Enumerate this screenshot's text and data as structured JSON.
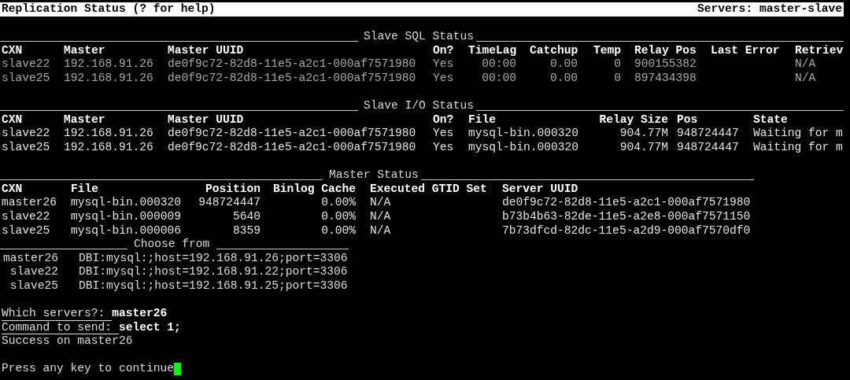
{
  "title_bar": {
    "title": "Replication Status (? for help)",
    "servers": "Servers: master-slave"
  },
  "slave_sql_status": {
    "title": "Slave SQL Status",
    "columns": [
      "CXN",
      "Master",
      "Master UUID",
      "On?",
      "TimeLag",
      "Catchup",
      "Temp",
      "Relay Pos",
      "Last Error",
      "Retriev"
    ],
    "rows": [
      [
        "slave22",
        "192.168.91.26",
        "de0f9c72-82d8-11e5-a2c1-000af7571980",
        "Yes",
        "00:00",
        "0.00",
        "0",
        "900155382",
        null,
        "N/A"
      ],
      [
        "slave25",
        "192.168.91.26",
        "de0f9c72-82d8-11e5-a2c1-000af7571980",
        "Yes",
        "00:00",
        "0.00",
        "0",
        "897434398",
        null,
        "N/A"
      ]
    ]
  },
  "slave_io_status": {
    "title": "Slave I/O Status",
    "columns": [
      "CXN",
      "Master",
      "Master UUID",
      "On?",
      "File",
      "Relay Size",
      "Pos",
      "State"
    ],
    "rows": [
      [
        "slave22",
        "192.168.91.26",
        "de0f9c72-82d8-11e5-a2c1-000af7571980",
        "Yes",
        "mysql-bin.000320",
        "904.77M",
        "948724447",
        "Waiting for m"
      ],
      [
        "slave25",
        "192.168.91.26",
        "de0f9c72-82d8-11e5-a2c1-000af7571980",
        "Yes",
        "mysql-bin.000320",
        "904.77M",
        "948724447",
        "Waiting for m"
      ]
    ]
  },
  "master_status": {
    "title": "Master Status",
    "columns": [
      "CXN",
      "File",
      "Position",
      "Binlog Cache",
      "Executed GTID Set",
      "Server UUID"
    ],
    "rows": [
      [
        "master26",
        "mysql-bin.000320",
        "948724447",
        "0.00%",
        "N/A",
        "de0f9c72-82d8-11e5-a2c1-000af7571980"
      ],
      [
        "slave22",
        "mysql-bin.000009",
        "5640",
        "0.00%",
        "N/A",
        "b73b4b63-82de-11e5-a2e8-000af7571150"
      ],
      [
        "slave25",
        "mysql-bin.000006",
        "8359",
        "0.00%",
        "N/A",
        "7b73dfcd-82dc-11e5-a2d9-000af7570df0"
      ]
    ]
  },
  "choose_from": {
    "title": "Choose from",
    "servers": [
      {
        "name": "master26",
        "dsn": "DBI:mysql:;host=192.168.91.26;port=3306"
      },
      {
        "name": "slave22",
        "dsn": "DBI:mysql:;host=192.168.91.22;port=3306"
      },
      {
        "name": "slave25",
        "dsn": "DBI:mysql:;host=192.168.91.25;port=3306"
      }
    ]
  },
  "prompts": [
    {
      "label": "Which servers?:",
      "value": "master26"
    },
    {
      "label": "Command to send:",
      "value": "select 1;"
    }
  ],
  "message": "Success on master26",
  "continue_prompt": "Press any key to continue"
}
